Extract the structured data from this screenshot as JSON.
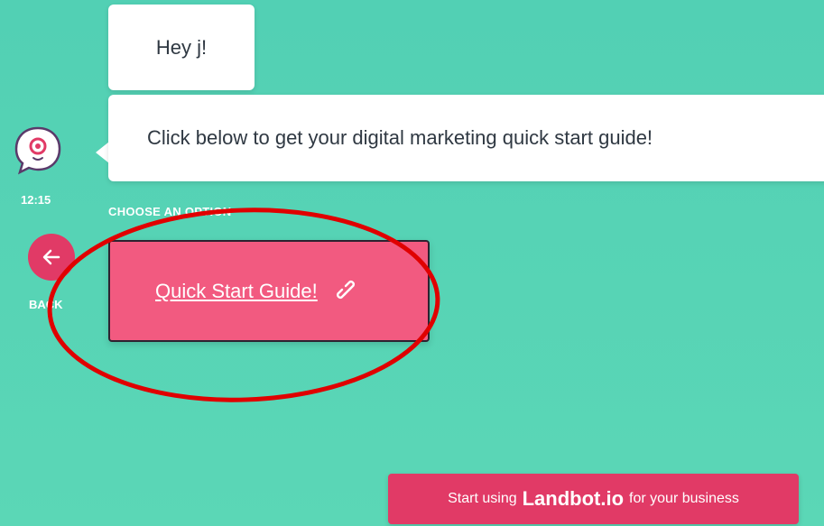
{
  "chat": {
    "messages": [
      {
        "text": "Hey j!"
      },
      {
        "text": "Click below to get your digital marketing quick start guide!"
      }
    ],
    "timestamp": "12:15",
    "options_label": "CHOOSE AN OPTION"
  },
  "nav": {
    "back_label": "BACK"
  },
  "options": [
    {
      "label": "Quick Start Guide!",
      "icon": "link-icon"
    }
  ],
  "promo": {
    "prefix": "Start using",
    "brand": "Landbot.io",
    "suffix": "for your business"
  },
  "colors": {
    "background": "#52d0b4",
    "accent": "#e13a66",
    "option_fill": "#f25a80",
    "highlight": "#e00000"
  }
}
